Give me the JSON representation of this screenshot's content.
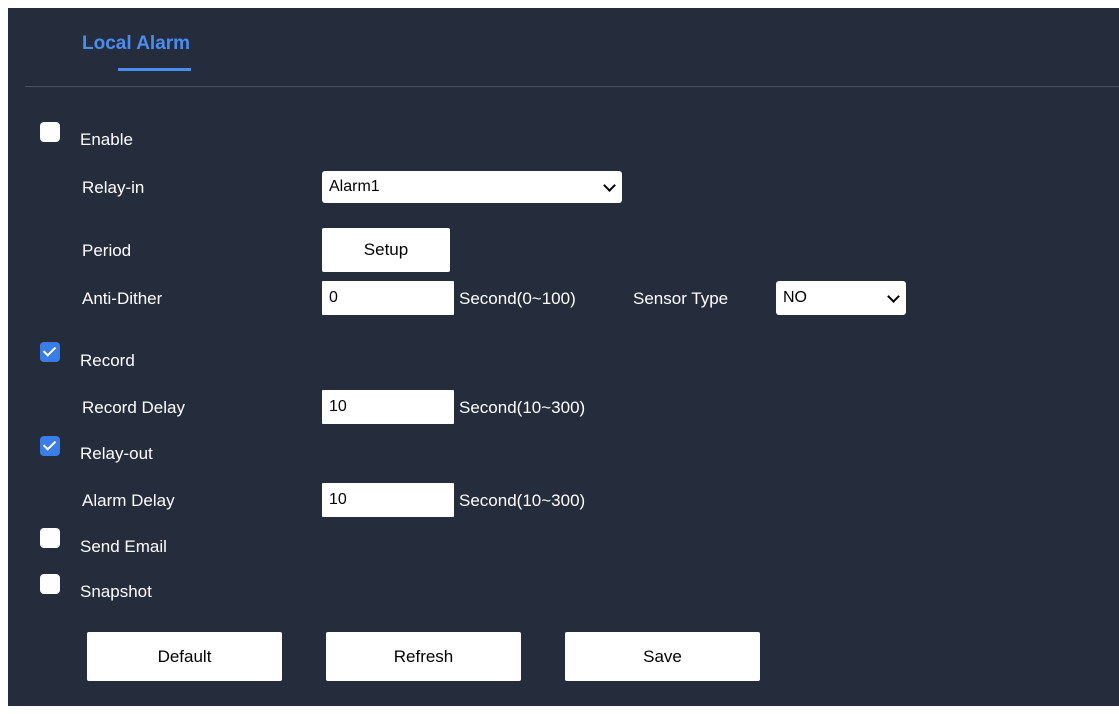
{
  "tabs": [
    {
      "label": "Local Alarm",
      "active": true
    }
  ],
  "colors": {
    "background": "#252d3d",
    "accent": "#4a8df0",
    "checkbox_checked": "#3b7de8"
  },
  "form": {
    "enable": {
      "label": "Enable",
      "checked": false
    },
    "relay_in": {
      "label": "Relay-in",
      "value": "Alarm1"
    },
    "period": {
      "label": "Period",
      "button": "Setup"
    },
    "anti_dither": {
      "label": "Anti-Dither",
      "value": "0",
      "unit": "Second(0~100)"
    },
    "sensor_type": {
      "label": "Sensor Type",
      "value": "NO"
    },
    "record": {
      "label": "Record",
      "checked": true
    },
    "record_delay": {
      "label": "Record Delay",
      "value": "10",
      "unit": "Second(10~300)"
    },
    "relay_out": {
      "label": "Relay-out",
      "checked": true
    },
    "alarm_delay": {
      "label": "Alarm Delay",
      "value": "10",
      "unit": "Second(10~300)"
    },
    "send_email": {
      "label": "Send Email",
      "checked": false
    },
    "snapshot": {
      "label": "Snapshot",
      "checked": false
    }
  },
  "actions": {
    "default": "Default",
    "refresh": "Refresh",
    "save": "Save"
  }
}
